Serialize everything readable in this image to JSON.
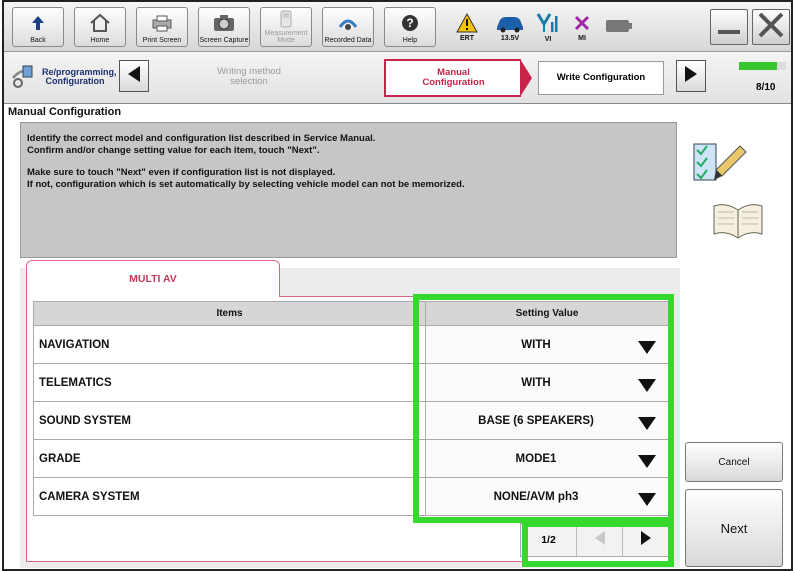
{
  "toolbar": {
    "buttons": [
      {
        "label": "Back",
        "icon": "back-icon"
      },
      {
        "label": "Home",
        "icon": "home-icon"
      },
      {
        "label": "Print Screen",
        "icon": "printer-icon"
      },
      {
        "label": "Screen Capture",
        "icon": "camera-icon"
      },
      {
        "label": "Measurement Mode",
        "icon": "measurement-icon"
      },
      {
        "label": "Recorded Data",
        "icon": "recorded-data-icon"
      },
      {
        "label": "Help",
        "icon": "help-icon"
      }
    ],
    "status": {
      "ert": "ERT",
      "voltage": "13.5V",
      "vi": "VI",
      "mi": "MI"
    }
  },
  "nav": {
    "steps": [
      "Re/programming, Configuration",
      "Writing method selection",
      "Manual Configuration",
      "Write Configuration"
    ],
    "progress": "8/10",
    "progress_fraction": 0.8
  },
  "page_title": "Manual Configuration",
  "instructions": {
    "line1": "Identify the correct model and configuration list described in Service Manual.",
    "line2": "Confirm and/or change setting value for each item, touch \"Next\".",
    "line3": "Make sure to touch \"Next\" even if configuration list is not displayed.",
    "line4": "If not, configuration which is set automatically by selecting vehicle model can not be memorized."
  },
  "tab": {
    "label": "MULTI AV"
  },
  "table": {
    "headers": [
      "Items",
      "Setting Value"
    ],
    "rows": [
      {
        "item": "NAVIGATION",
        "value": "WITH"
      },
      {
        "item": "TELEMATICS",
        "value": "WITH"
      },
      {
        "item": "SOUND SYSTEM",
        "value": "BASE (6 SPEAKERS)"
      },
      {
        "item": "GRADE",
        "value": "MODE1"
      },
      {
        "item": "CAMERA SYSTEM",
        "value": "NONE/AVM ph3"
      }
    ]
  },
  "pager": {
    "page": "1/2"
  },
  "actions": {
    "cancel": "Cancel",
    "next": "Next"
  },
  "colors": {
    "highlight": "#35d92d",
    "active_step": "#c8234a",
    "tab_accent": "#c33b5a"
  }
}
